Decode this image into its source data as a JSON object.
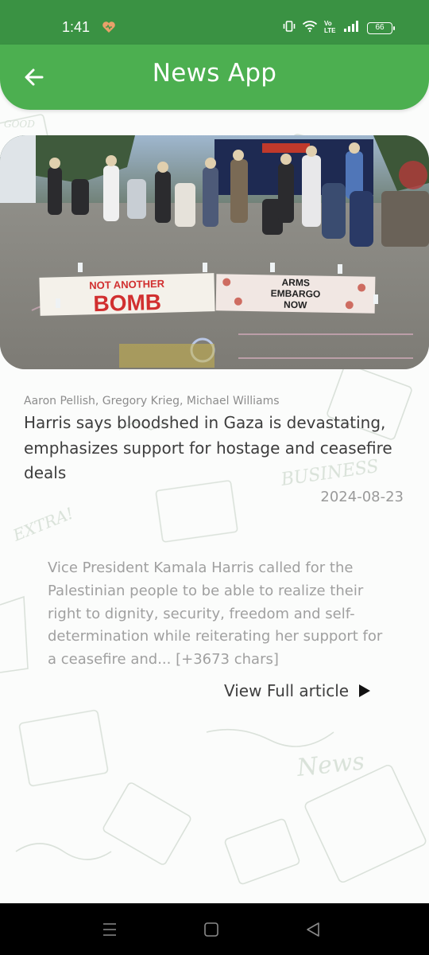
{
  "status_bar": {
    "time": "1:41",
    "battery": "66",
    "icons": [
      "heart-icon",
      "vibrate-icon",
      "wifi-icon",
      "volte-icon",
      "signal-icon",
      "battery-icon"
    ]
  },
  "app_bar": {
    "title": "News App",
    "back_icon": "arrow-left-icon"
  },
  "article": {
    "image_banner_left": [
      "NOT ANOTHER",
      "BOMB"
    ],
    "image_banner_right": [
      "ARMS",
      "EMBARGO",
      "NOW"
    ],
    "authors": "Aaron Pellish, Gregory Krieg, Michael Williams",
    "headline": "Harris says bloodshed in Gaza is devastating, emphasizes support for hostage and ceasefire deals",
    "date": "2024-08-23",
    "summary": "Vice President Kamala Harris called for the Palestinian people to be able to realize their right to dignity, security, freedom and self-determination while reiterating her support for a ceasefire and... [+3673 chars]",
    "view_full_label": "View Full article",
    "view_full_icon": "play-arrow-icon"
  },
  "nav_bar": {
    "icons": [
      "menu-icon",
      "home-square-icon",
      "back-triangle-icon"
    ]
  },
  "colors": {
    "status_bar": "#3a9243",
    "app_bar": "#4caf50",
    "headline": "#3d3d3d",
    "muted": "#a0a0a0"
  }
}
